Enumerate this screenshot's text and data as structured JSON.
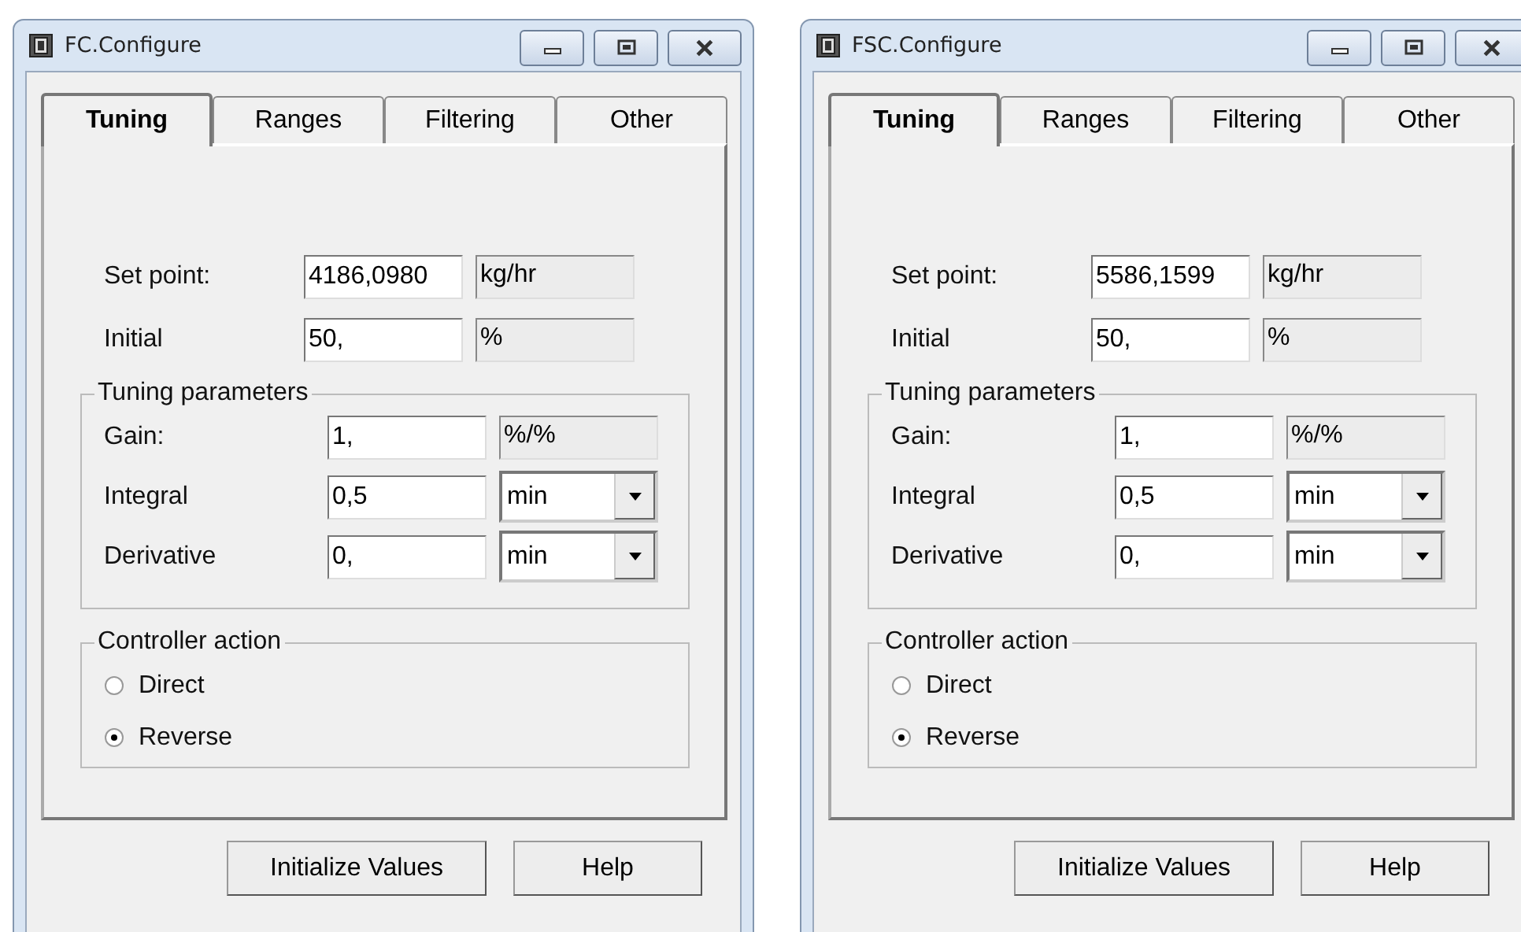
{
  "windows": [
    {
      "title": "FC.Configure",
      "tabs": [
        {
          "label": "Tuning",
          "selected": true
        },
        {
          "label": "Ranges",
          "selected": false
        },
        {
          "label": "Filtering",
          "selected": false
        },
        {
          "label": "Other",
          "selected": false
        }
      ],
      "rows": [
        {
          "label": "Set point:",
          "value": "4186,0980",
          "unit": "kg/hr",
          "kind": "text"
        },
        {
          "label": "Initial",
          "value": "50,",
          "unit": "%",
          "kind": "text"
        }
      ],
      "tuning_parameters": {
        "title": "Tuning parameters",
        "rows": [
          {
            "label": "Gain:",
            "value": "1,",
            "unit": "%/%",
            "kind": "text"
          },
          {
            "label": "Integral",
            "value": "0,5",
            "unit": "min",
            "kind": "select"
          },
          {
            "label": "Derivative",
            "value": "0,",
            "unit": "min",
            "kind": "select"
          }
        ]
      },
      "controller_action": {
        "title": "Controller action",
        "options": [
          {
            "label": "Direct",
            "selected": false
          },
          {
            "label": "Reverse",
            "selected": true
          }
        ]
      },
      "buttons": [
        "Initialize Values",
        "Help"
      ]
    },
    {
      "title": "FSC.Configure",
      "tabs": [
        {
          "label": "Tuning",
          "selected": true
        },
        {
          "label": "Ranges",
          "selected": false
        },
        {
          "label": "Filtering",
          "selected": false
        },
        {
          "label": "Other",
          "selected": false
        }
      ],
      "rows": [
        {
          "label": "Set point:",
          "value": "5586,1599",
          "unit": "kg/hr",
          "kind": "text"
        },
        {
          "label": "Initial",
          "value": "50,",
          "unit": "%",
          "kind": "text"
        }
      ],
      "tuning_parameters": {
        "title": "Tuning parameters",
        "rows": [
          {
            "label": "Gain:",
            "value": "1,",
            "unit": "%/%",
            "kind": "text"
          },
          {
            "label": "Integral",
            "value": "0,5",
            "unit": "min",
            "kind": "select"
          },
          {
            "label": "Derivative",
            "value": "0,",
            "unit": "min",
            "kind": "select"
          }
        ]
      },
      "controller_action": {
        "title": "Controller action",
        "options": [
          {
            "label": "Direct",
            "selected": false
          },
          {
            "label": "Reverse",
            "selected": true
          }
        ]
      },
      "buttons": [
        "Initialize Values",
        "Help"
      ]
    }
  ]
}
